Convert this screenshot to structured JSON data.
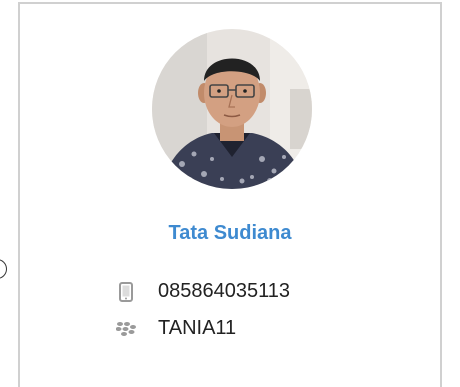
{
  "profile": {
    "name": "Tata Sudiana",
    "phone": "085864035113",
    "bbm_pin": "TANIA11"
  },
  "icons": {
    "phone": "mobile-phone-icon",
    "pin": "blackberry-icon"
  },
  "colors": {
    "name_link": "#3e8ad0",
    "card_border": "#d0d0d0",
    "icon_gray": "#9a9a9a"
  }
}
